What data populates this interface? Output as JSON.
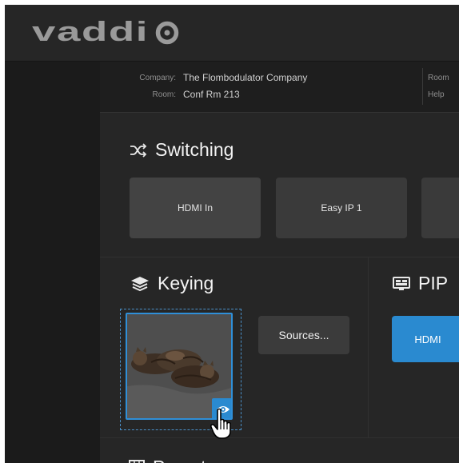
{
  "brand": {
    "logo_text": "vaddio"
  },
  "room_info": {
    "company_label": "Company:",
    "company_value": "The Flombodulator Company",
    "room_label": "Room:",
    "room_value": "Conf Rm 213",
    "right_top_label": "Room",
    "right_bottom_label": "Help"
  },
  "switching": {
    "title": "Switching",
    "icon": "shuffle-icon",
    "sources": [
      {
        "label": "HDMI In",
        "active": true
      },
      {
        "label": "Easy IP 1",
        "active": false
      },
      {
        "label": "",
        "active": false
      }
    ]
  },
  "keying": {
    "title": "Keying",
    "icon": "layers-icon",
    "sources_button": "Sources...",
    "preview_icon": "eye-icon"
  },
  "pip": {
    "title": "PIP",
    "icon": "monitor-icon",
    "button_label": "HDMI"
  },
  "presets": {
    "title": "Presets",
    "icon": "grid-icon"
  },
  "colors": {
    "accent": "#2a8ad0",
    "background": "#262626"
  }
}
